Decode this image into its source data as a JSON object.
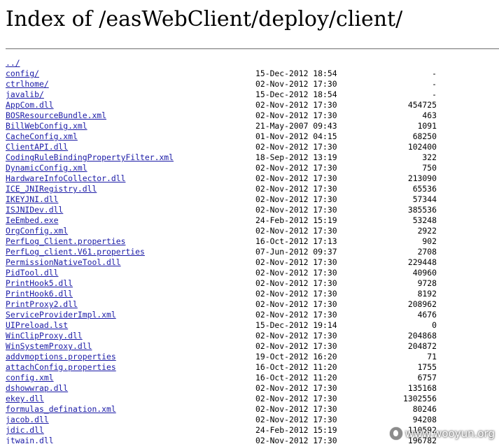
{
  "page": {
    "title": "Index of /easWebClient/deploy/client/"
  },
  "listing": [
    {
      "name": "../",
      "date": "",
      "size": ""
    },
    {
      "name": "config/",
      "date": "15-Dec-2012 18:54",
      "size": "-"
    },
    {
      "name": "ctrlhome/",
      "date": "02-Nov-2012 17:30",
      "size": "-"
    },
    {
      "name": "javalib/",
      "date": "15-Dec-2012 18:54",
      "size": "-"
    },
    {
      "name": "AppCom.dll",
      "date": "02-Nov-2012 17:30",
      "size": "454725"
    },
    {
      "name": "BOSResourceBundle.xml",
      "date": "02-Nov-2012 17:30",
      "size": "463"
    },
    {
      "name": "BillWebConfig.xml",
      "date": "21-May-2007 09:43",
      "size": "1091"
    },
    {
      "name": "CacheConfig.xml",
      "date": "01-Nov-2012 04:15",
      "size": "68250"
    },
    {
      "name": "ClientAPI.dll",
      "date": "02-Nov-2012 17:30",
      "size": "102400"
    },
    {
      "name": "CodingRuleBindingPropertyFilter.xml",
      "date": "18-Sep-2012 13:19",
      "size": "322"
    },
    {
      "name": "DynamicConfig.xml",
      "date": "02-Nov-2012 17:30",
      "size": "750"
    },
    {
      "name": "HardwareInfoCollector.dll",
      "date": "02-Nov-2012 17:30",
      "size": "213090"
    },
    {
      "name": "ICE_JNIRegistry.dll",
      "date": "02-Nov-2012 17:30",
      "size": "65536"
    },
    {
      "name": "IKEYJNI.dll",
      "date": "02-Nov-2012 17:30",
      "size": "57344"
    },
    {
      "name": "ISJNIDev.dll",
      "date": "02-Nov-2012 17:30",
      "size": "385536"
    },
    {
      "name": "IeEmbed.exe",
      "date": "24-Feb-2012 15:19",
      "size": "53248"
    },
    {
      "name": "OrgConfig.xml",
      "date": "02-Nov-2012 17:30",
      "size": "2922"
    },
    {
      "name": "PerfLog_Client.properties",
      "date": "16-Oct-2012 17:13",
      "size": "902"
    },
    {
      "name": "PerfLog_client.V61.properties",
      "date": "07-Jun-2012 09:37",
      "size": "2708"
    },
    {
      "name": "PermissionNativeTool.dll",
      "date": "02-Nov-2012 17:30",
      "size": "229448"
    },
    {
      "name": "PidTool.dll",
      "date": "02-Nov-2012 17:30",
      "size": "40960"
    },
    {
      "name": "PrintHook5.dll",
      "date": "02-Nov-2012 17:30",
      "size": "9728"
    },
    {
      "name": "PrintHook6.dll",
      "date": "02-Nov-2012 17:30",
      "size": "8192"
    },
    {
      "name": "PrintProxy2.dll",
      "date": "02-Nov-2012 17:30",
      "size": "208962"
    },
    {
      "name": "ServiceProviderImpl.xml",
      "date": "02-Nov-2012 17:30",
      "size": "4676"
    },
    {
      "name": "UIPreload.lst",
      "date": "15-Dec-2012 19:14",
      "size": "0"
    },
    {
      "name": "WinClipProxy.dll",
      "date": "02-Nov-2012 17:30",
      "size": "204868"
    },
    {
      "name": "WinSystemProxy.dll",
      "date": "02-Nov-2012 17:30",
      "size": "204872"
    },
    {
      "name": "addvmoptions.properties",
      "date": "19-Oct-2012 16:20",
      "size": "71"
    },
    {
      "name": "attachConfig.properties",
      "date": "16-Oct-2012 11:20",
      "size": "1755"
    },
    {
      "name": "config.xml",
      "date": "16-Oct-2012 11:20",
      "size": "6757"
    },
    {
      "name": "dshowwrap.dll",
      "date": "02-Nov-2012 17:30",
      "size": "135168"
    },
    {
      "name": "ekey.dll",
      "date": "02-Nov-2012 17:30",
      "size": "1302556"
    },
    {
      "name": "formulas_defination.xml",
      "date": "02-Nov-2012 17:30",
      "size": "80246"
    },
    {
      "name": "jacob.dll",
      "date": "02-Nov-2012 17:30",
      "size": "94208"
    },
    {
      "name": "jdic.dll",
      "date": "24-Feb-2012 15:19",
      "size": "110592"
    },
    {
      "name": "jtwain.dll",
      "date": "02-Nov-2012 17:30",
      "size": "196782"
    }
  ],
  "watermark": {
    "text": "www.wooyun.org",
    "icon": "wooyun-logo-icon"
  }
}
